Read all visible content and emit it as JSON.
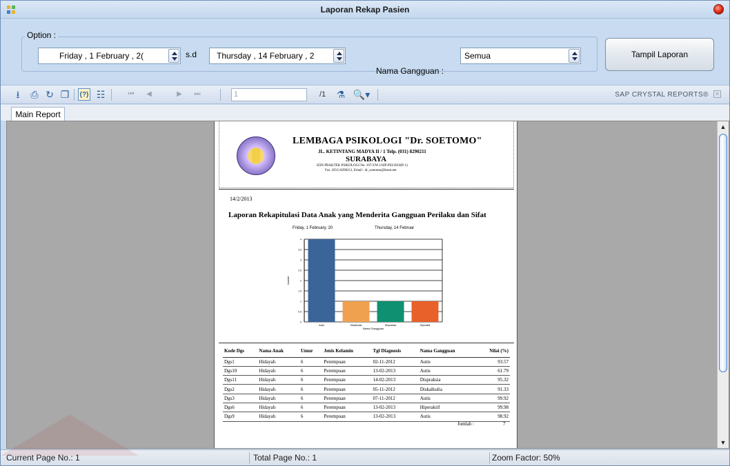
{
  "window": {
    "title": "Laporan Rekap Pasien"
  },
  "options": {
    "group_label": "Option :",
    "date_from": "Friday   ,  1  February  , 2(",
    "sd_label": "s.d",
    "date_to": "Thursday , 14  February  , 2",
    "gangguan_label": "Nama Gangguan :",
    "gangguan_value": "Semua",
    "tampil_button": "Tampil Laporan"
  },
  "toolbar": {
    "page_value": "1",
    "page_total": "/1",
    "brand": "SAP CRYSTAL REPORTS®"
  },
  "tabs": [
    "Main Report"
  ],
  "report": {
    "org_name": "LEMBAGA PSIKOLOGI  \"Dr. SOETOMO\"",
    "address": "JL. KETINTANG MADYA II / 1 Telp. (031) 8290211",
    "city": "SURABAYA",
    "izin": "IZIN PRAKTEK PSIKOLOGI No. 107/3/W.1/SIP-PSI/2010(P-1)",
    "fax": "Fax. (031) 8290211, Email : dr_soetomo@ikom.net",
    "date": "14/2/2013",
    "title": "Laporan Rekapitulasi Data Anak yang Menderita Gangguan Perilaku dan Sifat",
    "period_from": "Friday, 1 February, 20",
    "period_to": "Thursday, 14 Februar",
    "columns": [
      "Kode Dgs",
      "Nama Anak",
      "Umur",
      "Jenis Kelamin",
      "Tgl Diagnosis",
      "Nama Gangguan",
      "Nilai (%)"
    ],
    "rows": [
      [
        "Dgs1",
        "Hidayah",
        "6",
        "Perempuan",
        "02-11-2012",
        "Autis",
        "93.57"
      ],
      [
        "Dgs10",
        "Hidayah",
        "6",
        "Perempuan",
        "13-02-2013",
        "Autis",
        "61.79"
      ],
      [
        "Dgs11",
        "Hidayah",
        "6",
        "Perempuan",
        "14-02-2013",
        "Dispraksia",
        "95.32"
      ],
      [
        "Dgs2",
        "Hidayah",
        "6",
        "Perempuan",
        "05-11-2012",
        "Diskalkulia",
        "91.33"
      ],
      [
        "Dgs3",
        "Hidayah",
        "6",
        "Perempuan",
        "07-11-2012",
        "Autis",
        "99.92"
      ],
      [
        "Dgs6",
        "Hidayah",
        "6",
        "Perempuan",
        "13-02-2013",
        "Hiperaktif",
        "99.98"
      ],
      [
        "Dgs9",
        "Hidayah",
        "6",
        "Perempuan",
        "13-02-2013",
        "Autis",
        "98.92"
      ]
    ],
    "jumlah_label": "Jumlah :",
    "jumlah_value": "7"
  },
  "chart_data": {
    "type": "bar",
    "categories": [
      "Autis",
      "Diskalkulia",
      "Dispraksia",
      "Hiperaktif"
    ],
    "values": [
      4,
      1,
      1,
      1
    ],
    "colors": [
      "#3b6498",
      "#f0a150",
      "#0f9070",
      "#e8602a"
    ],
    "xlabel": "Nama Gangguan",
    "ylabel": "Jumlah",
    "ylim": [
      0,
      4
    ],
    "yticks": [
      "0",
      "0.5",
      "1",
      "1.5",
      "2",
      "2.5",
      "3",
      "3.5",
      "4"
    ],
    "grid": true
  },
  "status": {
    "current_page": "Current Page No.: 1",
    "total_page": "Total Page No.: 1",
    "zoom": "Zoom Factor: 50%"
  }
}
